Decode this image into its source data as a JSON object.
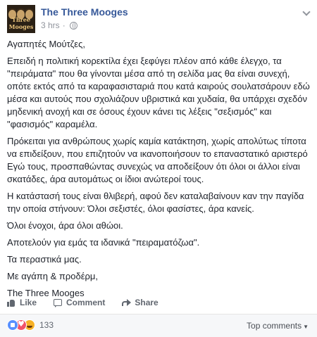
{
  "post": {
    "page_name": "The Three Mooges",
    "time": "3 hrs",
    "separator": "·",
    "avatar_icon": "page-avatar-three-faces",
    "privacy_icon": "globe-icon",
    "menu_icon": "chevron-down-icon",
    "paragraphs": [
      "Αγαπητές Μούτζες,",
      "Επειδή η πολιτική κορεκτίλα έχει ξεφύγει πλέον από κάθε έλεγχο, τα \"πειράματα\" που θα γίνονται μέσα από τη σελίδα μας θα είναι συνεχή, οπότε εκτός από τα καραφασισταριά που κατά καιρούς σουλατσάρουν εδώ μέσα και αυτούς που σχολιάζουν υβριστικά και χυδαία, θα υπάρχει σχεδόν μηδενική ανοχή και σε όσους έχουν κάνει τις λέξεις \"σεξισμός\" και \"φασισμός\" καραμέλα.",
      "Πρόκειται για ανθρώπους χωρίς καμία κατάκτηση, χωρίς απολύτως τίποτα να επιδείξουν, που επιζητούν να ικανοποιήσουν το επαναστατικό αριστερό Εγώ τους, προσπαθώντας συνεχώς να αποδείξουν ότι όλοι οι άλλοι είναι σκατάδες, άρα αυτομάτως οι ίδιοι ανώτεροί τους.",
      "Η κατάστασή τους είναι θλιβερή, αφού δεν καταλαβαίνουν καν την παγίδα την οποία στήνουν: Όλοι σεξιστές, όλοι φασίστες, άρα κανείς.",
      "Όλοι ένοχοι, άρα όλοι αθώοι.",
      "Αποτελούν για εμάς τα ιδανικά \"πειραματόζωα\".",
      "Τα περαστικά μας.",
      "Με αγάπη & προδέρμ,",
      "The Three Mooges"
    ]
  },
  "actions": {
    "like_label": "Like",
    "comment_label": "Comment",
    "share_label": "Share"
  },
  "footer": {
    "reaction_icons": [
      "like-reaction-icon",
      "love-reaction-icon",
      "haha-reaction-icon"
    ],
    "reaction_count": "133",
    "sort_label": "Top comments",
    "sort_caret": "▼"
  },
  "colors": {
    "page_link": "#365899",
    "meta_text": "#90949c",
    "action_text": "#616770",
    "footer_bg": "#f6f7f9"
  }
}
